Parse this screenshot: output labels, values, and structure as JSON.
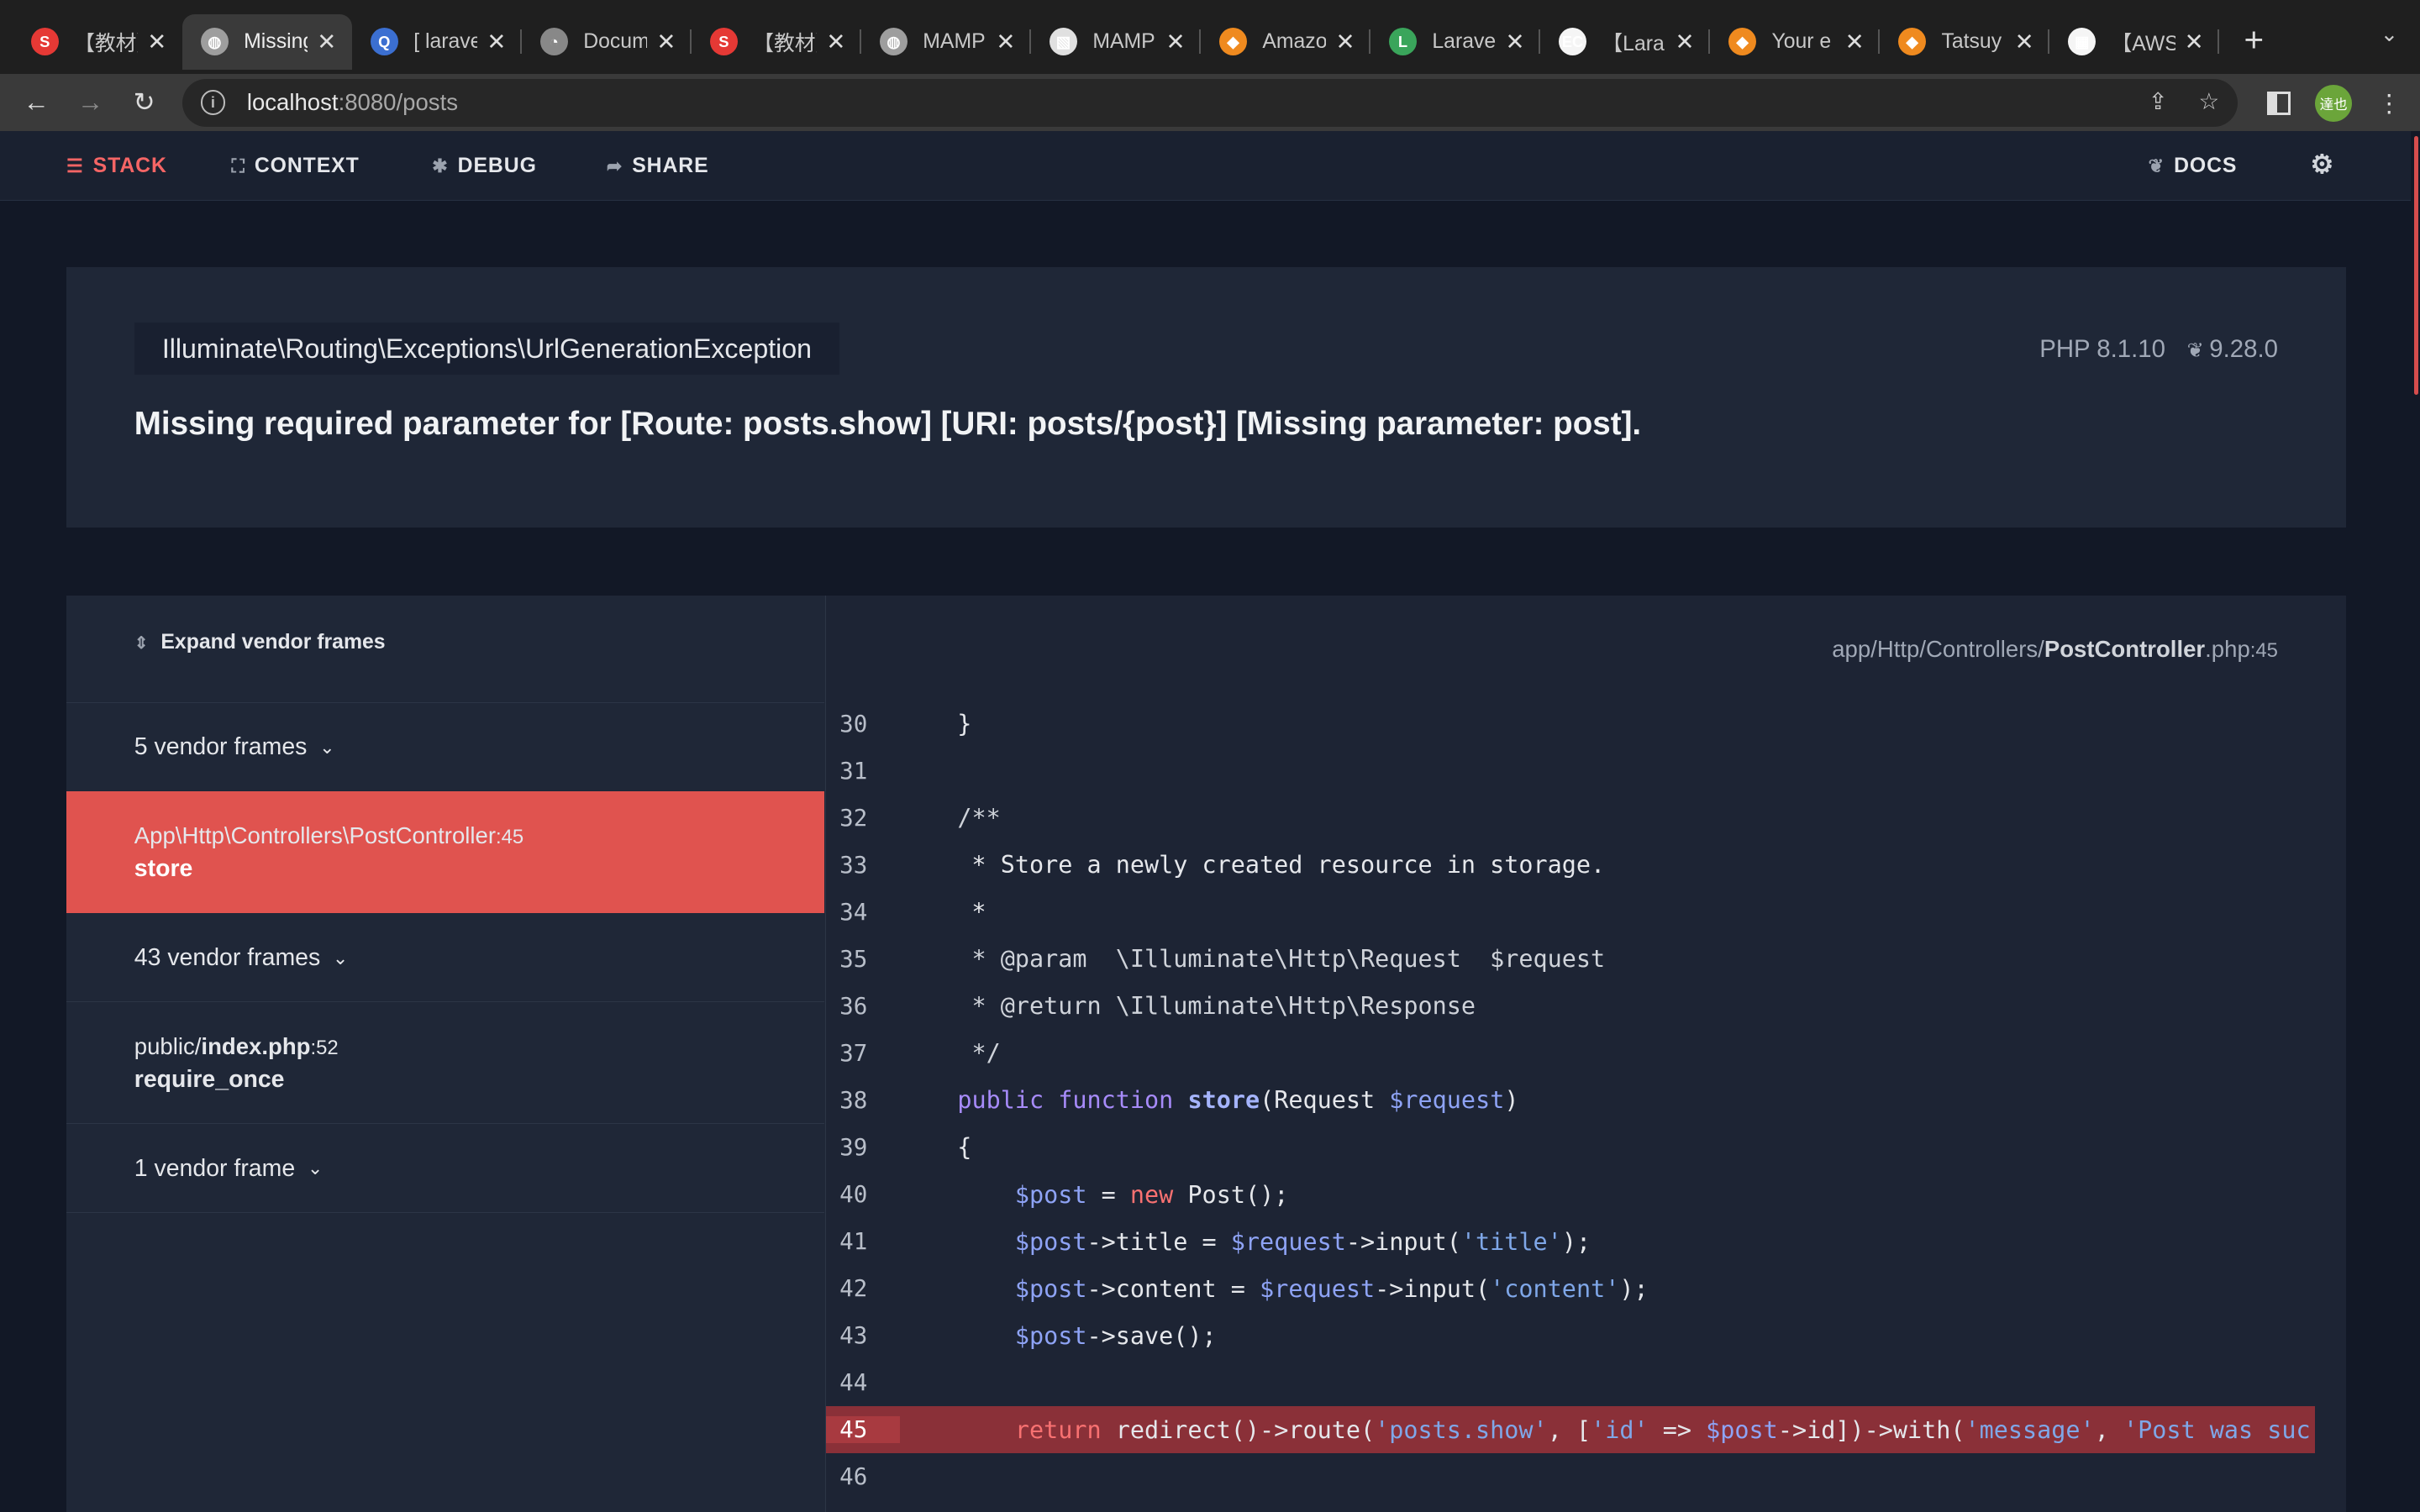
{
  "browser": {
    "tabs": [
      {
        "title": "【教材】",
        "fav_color": "#e53935",
        "fav_glyph": "S"
      },
      {
        "title": "Missing",
        "fav_color": "#9e9e9e",
        "fav_glyph": "◍"
      },
      {
        "title": "[ laravel",
        "fav_color": "#3b6fd1",
        "fav_glyph": "Q"
      },
      {
        "title": "Docum",
        "fav_color": "#888",
        "fav_glyph": "◔"
      },
      {
        "title": "【教材】",
        "fav_color": "#e53935",
        "fav_glyph": "S"
      },
      {
        "title": "MAMP",
        "fav_color": "#9e9e9e",
        "fav_glyph": "◍"
      },
      {
        "title": "MAMP",
        "fav_color": "#e0e0e0",
        "fav_glyph": "▧"
      },
      {
        "title": "Amazo",
        "fav_color": "#ef8a1f",
        "fav_glyph": "◆"
      },
      {
        "title": "Larave",
        "fav_color": "#3aa55b",
        "fav_glyph": "L"
      },
      {
        "title": "【Lara",
        "fav_color": "#f5f5f5",
        "fav_glyph": "EC"
      },
      {
        "title": "Your e",
        "fav_color": "#ef8a1f",
        "fav_glyph": "◆"
      },
      {
        "title": "Tatsuy",
        "fav_color": "#ef8a1f",
        "fav_glyph": "◆"
      },
      {
        "title": "【AWS",
        "fav_color": "#f5f5f5",
        "fav_glyph": "▦"
      }
    ],
    "active_tab": 1,
    "new_tab": "+",
    "url_host": "localhost",
    "url_rest": ":8080/posts",
    "avatar_text": "達也"
  },
  "ignition_nav": {
    "stack": "STACK",
    "context": "CONTEXT",
    "debug": "DEBUG",
    "share": "SHARE",
    "docs": "DOCS"
  },
  "exception": {
    "class": "Illuminate\\Routing\\Exceptions\\UrlGenerationException",
    "php_version": "PHP 8.1.10",
    "laravel_version": "9.28.0",
    "message": "Missing required parameter for [Route: posts.show] [URI: posts/{post}] [Missing parameter: post]."
  },
  "frames": {
    "expand_label": "Expand vendor frames",
    "vendor_group_1": "5 vendor frames",
    "selected_class": "App\\Http\\Controllers\\PostController",
    "selected_line": ":45",
    "selected_fn": "store",
    "vendor_group_2": "43 vendor frames",
    "public_dir": "public/",
    "public_file": "index.php",
    "public_line": ":52",
    "public_fn": "require_once",
    "vendor_group_3": "1 vendor frame"
  },
  "code": {
    "path_dir": "app/Http/Controllers/",
    "path_file": "PostController",
    "path_ext": ".php",
    "path_line": ":45",
    "highlight_line": 45,
    "lines": [
      {
        "no": "30",
        "html": "    }"
      },
      {
        "no": "31",
        "html": ""
      },
      {
        "no": "32",
        "html": "    <span class='c'>/**</span>"
      },
      {
        "no": "33",
        "html": "     * Store a newly created resource in storage."
      },
      {
        "no": "34",
        "html": "     *"
      },
      {
        "no": "35",
        "html": "     <span class='c'>* @param  \\Illuminate\\Http\\Request  $request</span>"
      },
      {
        "no": "36",
        "html": "     <span class='c'>* @return \\Illuminate\\Http\\Response</span>"
      },
      {
        "no": "37",
        "html": "     <span class='c'>*/</span>"
      },
      {
        "no": "38",
        "html": "    <span class='kw'>public</span> <span class='kw'>function</span> <span class='fnname'>store</span>(Request <span class='var'>$request</span>)"
      },
      {
        "no": "39",
        "html": "    {"
      },
      {
        "no": "40",
        "html": "        <span class='var'>$post</span> = <span class='ret'>new</span> Post();"
      },
      {
        "no": "41",
        "html": "        <span class='var'>$post</span>-&gt;title = <span class='var'>$request</span>-&gt;input(<span class='str'>'title'</span>);"
      },
      {
        "no": "42",
        "html": "        <span class='var'>$post</span>-&gt;content = <span class='var'>$request</span>-&gt;input(<span class='str'>'content'</span>);"
      },
      {
        "no": "43",
        "html": "        <span class='var'>$post</span>-&gt;save();"
      },
      {
        "no": "44",
        "html": ""
      },
      {
        "no": "45",
        "html": "        <span class='ret'>return</span> redirect()-&gt;route(<span class='str'>'posts.show'</span>, [<span class='str'>'id'</span> =&gt; <span class='var'>$post</span>-&gt;id])-&gt;with(<span class='str'>'message'</span>, <span class='str'>'Post was suc</span>"
      },
      {
        "no": "46",
        "html": ""
      }
    ]
  }
}
